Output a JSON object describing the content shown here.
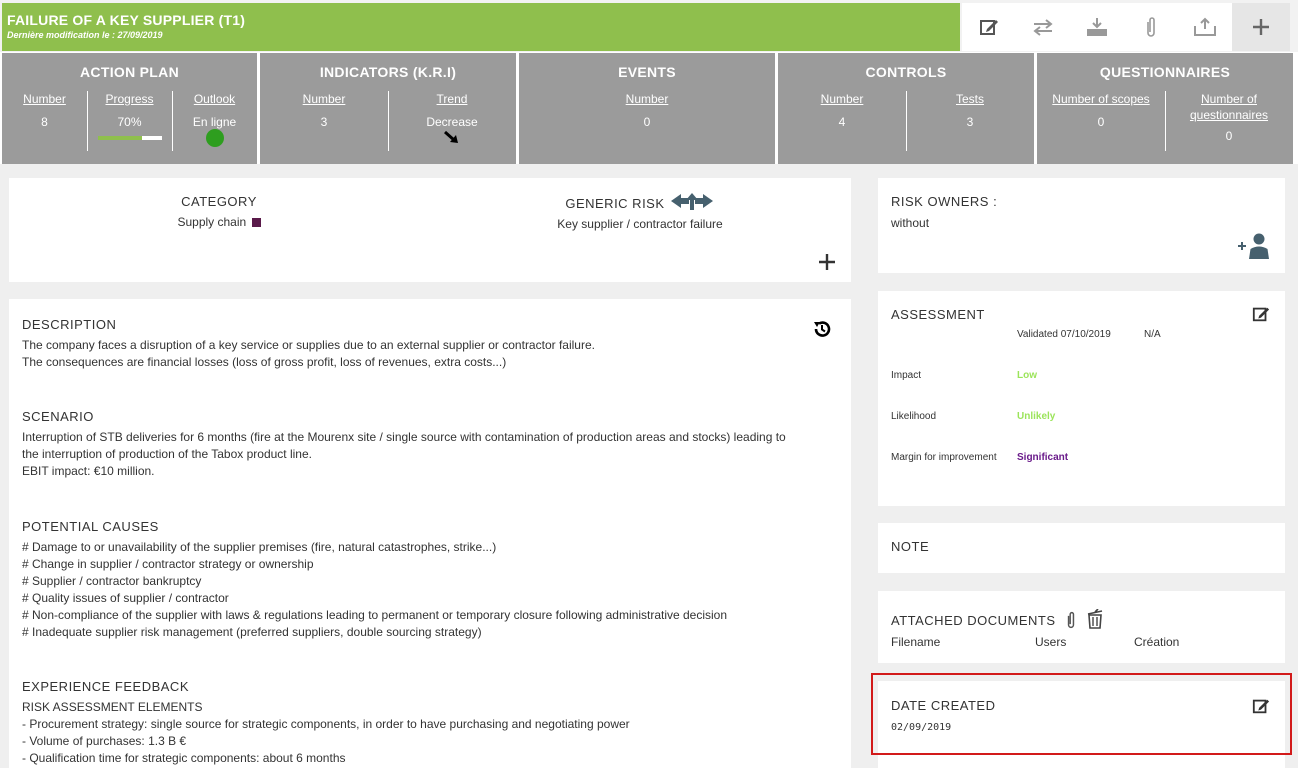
{
  "header": {
    "title": "FAILURE OF A KEY SUPPLIER (T1)",
    "subtitle": "Dernière modification le : 27/09/2019",
    "toolbar_icons": [
      "edit-icon",
      "transfer-icon",
      "download-icon",
      "paperclip-icon",
      "upload-icon",
      "plus-icon"
    ]
  },
  "kpis": {
    "action_plan": {
      "title": "ACTION PLAN",
      "number_label": "Number",
      "number_value": "8",
      "progress_label": "Progress",
      "progress_value": "70%",
      "progress_fraction": 0.7,
      "outlook_label": "Outlook",
      "outlook_value": "En ligne",
      "outlook_color": "#2e9e1f"
    },
    "indicators": {
      "title": "INDICATORS (K.R.I)",
      "number_label": "Number",
      "number_value": "3",
      "trend_label": "Trend",
      "trend_value": "Decrease"
    },
    "events": {
      "title": "EVENTS",
      "number_label": "Number",
      "number_value": "0"
    },
    "controls": {
      "title": "CONTROLS",
      "number_label": "Number",
      "number_value": "4",
      "tests_label": "Tests",
      "tests_value": "3"
    },
    "questionnaires": {
      "title": "QUESTIONNAIRES",
      "scopes_label": "Number of scopes",
      "scopes_value": "0",
      "questionnaires_label_1": "Number of",
      "questionnaires_label_2": "questionnaires",
      "questionnaires_value": "0"
    }
  },
  "category": {
    "title": "CATEGORY",
    "value": "Supply chain",
    "swatch_color": "#5a1a4a",
    "generic_risk_title": "GENERIC RISK",
    "generic_risk_value": "Key supplier / contractor failure"
  },
  "description": {
    "title": "DESCRIPTION",
    "lines": [
      "The company faces a disruption of a key service or supplies due to an external supplier or contractor failure.",
      "The consequences are financial losses (loss of gross profit, loss of revenues, extra costs...)"
    ]
  },
  "scenario": {
    "title": "SCENARIO",
    "lines": [
      "Interruption of STB deliveries for 6 months (fire at the Mourenx site / single source with contamination of production areas and stocks) leading to",
      "the interruption of production of the Tabox product line.",
      "EBIT impact: €10 million."
    ]
  },
  "causes": {
    "title": "POTENTIAL CAUSES",
    "lines": [
      "# Damage to or unavailability of the supplier premises (fire, natural catastrophes, strike...)",
      "# Change in supplier / contractor strategy or ownership",
      "# Supplier / contractor bankruptcy",
      "# Quality issues of supplier / contractor",
      "# Non-compliance of the supplier with laws & regulations leading to permanent or temporary closure following administrative decision",
      "# Inadequate supplier risk management (preferred suppliers, double sourcing strategy)"
    ]
  },
  "feedback": {
    "title": "EXPERIENCE FEEDBACK",
    "lines": [
      "RISK ASSESSMENT ELEMENTS",
      "- Procurement strategy: single source for strategic components, in order to have purchasing and negotiating power",
      "- Volume of purchases: 1.3 B €",
      "- Qualification time for strategic components: about 6 months"
    ]
  },
  "risk_owners": {
    "title": "RISK OWNERS :",
    "value": "without"
  },
  "assessment": {
    "title": "ASSESSMENT",
    "validated": "Validated 07/10/2019",
    "na": "N/A",
    "rows": [
      {
        "label": "Impact",
        "value": "Low",
        "color": "#9be45a"
      },
      {
        "label": "Likelihood",
        "value": "Unlikely",
        "color": "#9be45a"
      },
      {
        "label": "Margin for improvement",
        "value": "Significant",
        "color": "#6a1a8a"
      }
    ]
  },
  "note": {
    "title": "NOTE"
  },
  "attached": {
    "title": "ATTACHED DOCUMENTS",
    "col_filename": "Filename",
    "col_users": "Users",
    "col_creation": "Création"
  },
  "date_created": {
    "title": "DATE CREATED",
    "value": "02/09/2019"
  }
}
